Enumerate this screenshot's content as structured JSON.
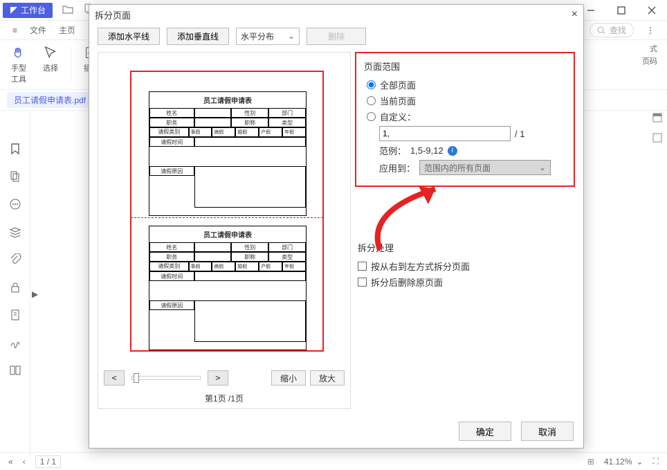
{
  "app": {
    "badge": "工作台"
  },
  "menubar": {
    "file": "文件",
    "home": "主页",
    "search_ph": "查找"
  },
  "ribbon": {
    "hand": "手型\n工具",
    "select": "选择",
    "insert": "插入",
    "r1": "式",
    "r2": "页码"
  },
  "filetab": {
    "name": "员工请假申请表.pdf"
  },
  "modal": {
    "title": "拆分页面",
    "btn_hline": "添加水平线",
    "btn_vline": "添加垂直线",
    "sel_dist": "水平分布",
    "btn_del": "删除",
    "pv_page": "第1页 /1页",
    "zoom_out": "缩小",
    "zoom_in": "放大"
  },
  "thumb": {
    "title": "员工请假申请表",
    "h_name": "姓名",
    "h_sex": "性别",
    "h_dept": "部门",
    "h_pos": "职务",
    "h_title": "职称",
    "h_type": "类型",
    "h_leave": "请假类别",
    "h_time": "请假时间",
    "h_reason": "请假原因",
    "c1": "事假",
    "c2": "病假",
    "c3": "婚假",
    "c4": "产假",
    "c5": "年假"
  },
  "range": {
    "title": "页面范围",
    "all": "全部页面",
    "cur": "当前页面",
    "custom": "自定义：",
    "val": "1,",
    "total": "/ 1",
    "example_lbl": "范例：",
    "example": "1,5-9,12",
    "apply_lbl": "应用到：",
    "apply_val": "范围内的所有页面"
  },
  "proc": {
    "title": "拆分处理",
    "rtl": "按从右到左方式拆分页面",
    "del": "拆分后删除原页面"
  },
  "foot": {
    "ok": "确定",
    "cancel": "取消"
  },
  "status": {
    "page_field": "1 / 1",
    "zoom": "41.12%"
  }
}
